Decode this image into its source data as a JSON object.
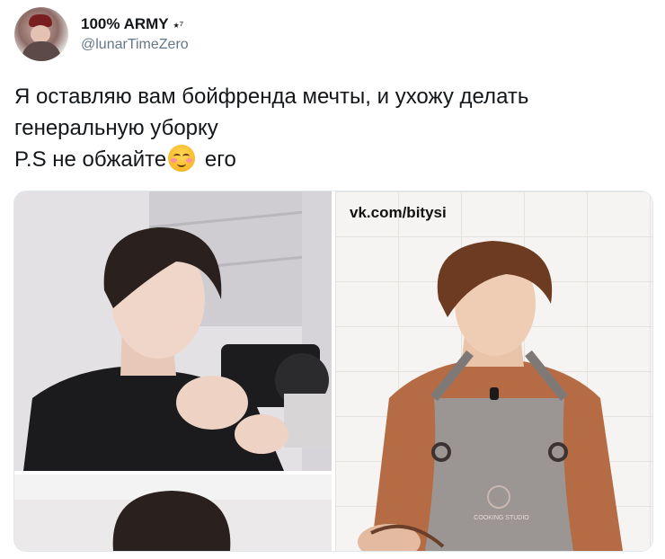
{
  "author": {
    "display_name": "100% ARMY",
    "name_suffix": "⭑⁷",
    "handle": "@lunarTimeZero"
  },
  "tweet": {
    "line1": "Я оставляю вам бойфренда мечты, и ухожу делать",
    "line2": "генеральную уборку",
    "line3_before_emoji": "P.S не обжайте",
    "line3_after_emoji": " его",
    "emoji": "smiling-face-with-blushing-cheeks"
  },
  "media": {
    "watermark": "vk.com/bitysi",
    "apron_text": "COOKING STUDIO"
  }
}
